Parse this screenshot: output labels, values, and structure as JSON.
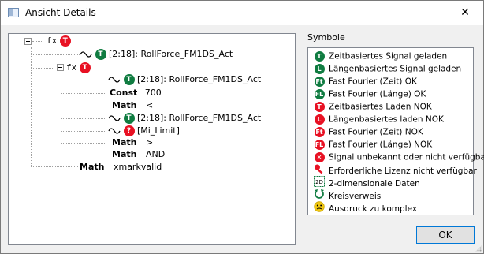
{
  "window": {
    "title": "Ansicht Details",
    "close_symbol": "✕"
  },
  "tree": {
    "root_label": "fx",
    "root_badge": "T",
    "nodes": [
      {
        "kw": "",
        "text": "[2:18]: RollForce_FM1DS_Act",
        "badge": "T",
        "wave": true
      },
      {
        "kw": "",
        "text": "",
        "badge": "T",
        "fx": "fx"
      },
      {
        "kw": "",
        "text": "[2:18]: RollForce_FM1DS_Act",
        "badge": "T",
        "wave": true
      },
      {
        "kw": "Const",
        "text": "700"
      },
      {
        "kw": "Math",
        "text": "<"
      },
      {
        "kw": "",
        "text": "[2:18]: RollForce_FM1DS_Act",
        "badge": "T",
        "wave": true
      },
      {
        "kw": "",
        "text": "[Mi_Limit]",
        "badge": "?",
        "wave": true
      },
      {
        "kw": "Math",
        "text": ">"
      },
      {
        "kw": "Math",
        "text": "AND"
      },
      {
        "kw": "Math",
        "text": "xmarkvalid"
      }
    ]
  },
  "symbols": {
    "label": "Symbole",
    "items": [
      {
        "badge": "T",
        "color": "#107c41",
        "icon": "time-signal-loaded-icon",
        "text": "Zeitbasiertes Signal geladen"
      },
      {
        "badge": "L",
        "color": "#107c41",
        "icon": "length-signal-loaded-icon",
        "text": "Längenbasiertes Signal geladen"
      },
      {
        "badge": "Ft",
        "color": "#107c41",
        "icon": "fft-time-ok-icon",
        "text": "Fast Fourier (Zeit) OK"
      },
      {
        "badge": "FL",
        "color": "#107c41",
        "icon": "fft-length-ok-icon",
        "text": "Fast Fourier (Länge) OK"
      },
      {
        "badge": "T",
        "color": "#e81123",
        "icon": "time-load-nok-icon",
        "text": "Zeitbasiertes Laden NOK"
      },
      {
        "badge": "L",
        "color": "#e81123",
        "icon": "length-load-nok-icon",
        "text": "Längenbasiertes laden NOK"
      },
      {
        "badge": "Ft",
        "color": "#e81123",
        "icon": "fft-time-nok-icon",
        "text": "Fast Fourier (Zeit) NOK"
      },
      {
        "badge": "FL",
        "color": "#e81123",
        "icon": "fft-length-nok-icon",
        "text": "Fast Fourier (Länge) NOK"
      },
      {
        "badge": "✕",
        "color": "#e81123",
        "icon": "signal-unknown-icon",
        "text": "Signal unbekannt oder nicht verfügbar"
      },
      {
        "badge": "key",
        "color": "#e81123",
        "icon": "license-key-icon",
        "text": "Erforderliche Lizenz nicht verfügbar"
      },
      {
        "badge": "2D",
        "color": "#107c41",
        "icon": "two-dimensional-data-icon",
        "text": "2-dimensionale Daten"
      },
      {
        "badge": "loop",
        "color": "#107c41",
        "icon": "circular-reference-icon",
        "text": "Kreisverweis"
      },
      {
        "badge": "face",
        "color": "#f2c811",
        "icon": "too-complex-face-icon",
        "text": "Ausdruck zu komplex"
      }
    ]
  },
  "buttons": {
    "ok": "OK"
  }
}
